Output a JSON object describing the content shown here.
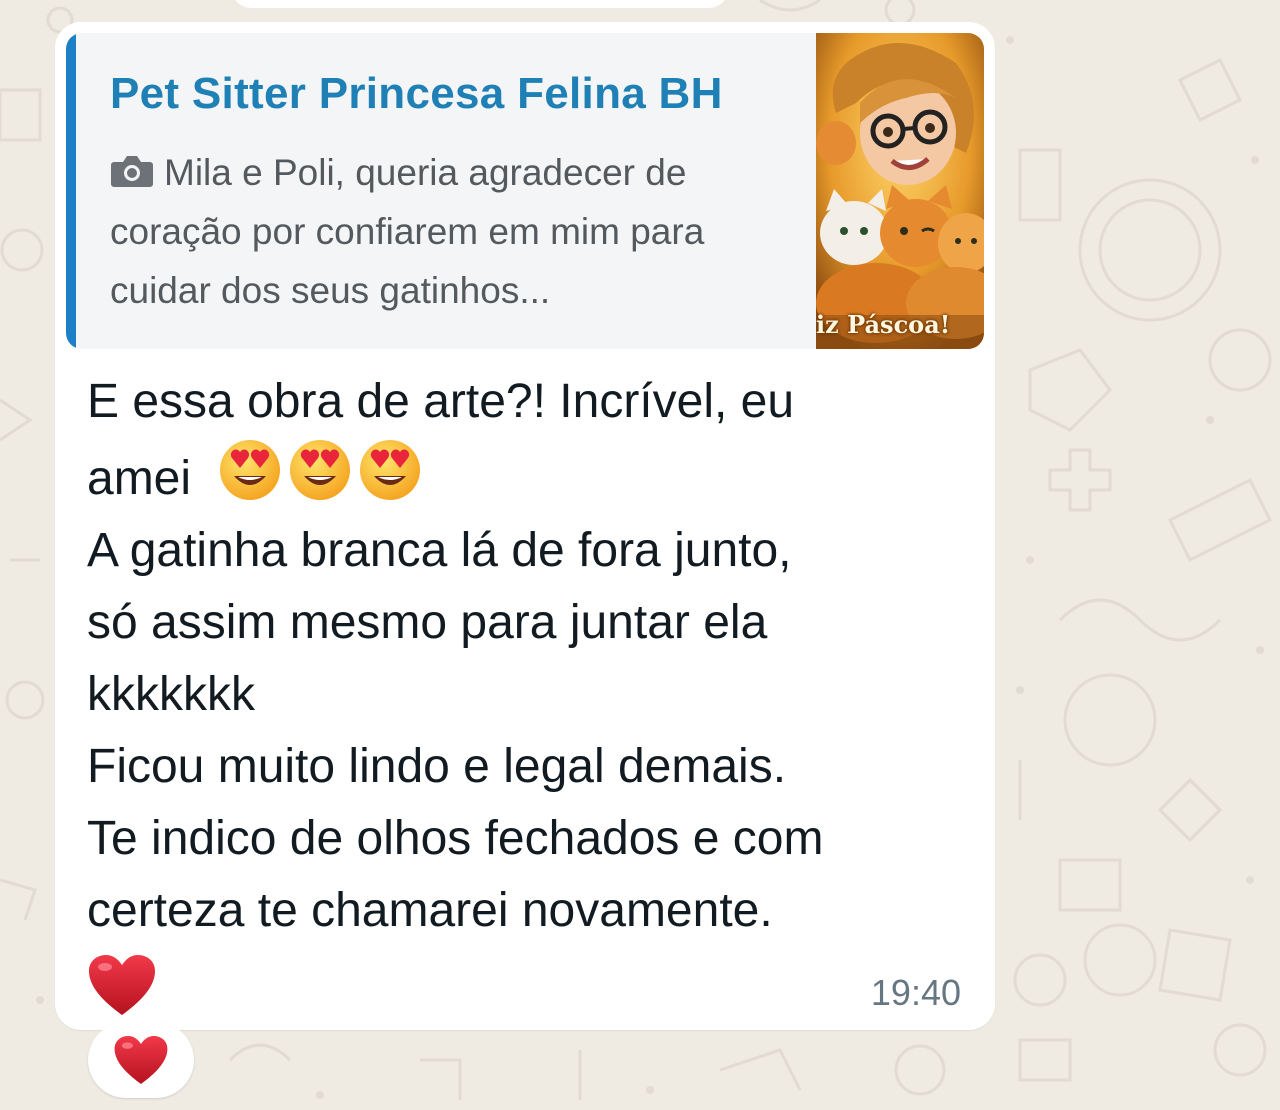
{
  "quoted_message": {
    "author": "Pet Sitter Princesa Felina BH",
    "media_icon": "camera-icon",
    "text": "Mila e Poli, queria agradecer de coração por confiarem em mim para cuidar dos seus gatinhos...",
    "thumbnail_caption": "iz Páscoa!"
  },
  "message": {
    "lines": [
      "E essa obra de arte?! Incrível, eu",
      "amei",
      "A gatinha branca lá de fora junto,",
      "só assim mesmo para juntar ela",
      "kkkkkkk",
      "Ficou muito lindo e legal demais.",
      "Te indico de olhos fechados e com",
      "certeza te chamarei novamente."
    ],
    "emojis_after_amei": [
      "heart-eyes-emoji",
      "heart-eyes-emoji",
      "heart-eyes-emoji"
    ],
    "trailing_emoji": "red-heart-emoji",
    "time": "19:40"
  },
  "reaction": {
    "emoji": "red-heart-emoji"
  },
  "colors": {
    "quote_author": "#1f80b6",
    "quote_bar": "#1d80c7",
    "background": "#efeae2",
    "bubble": "#ffffff"
  }
}
